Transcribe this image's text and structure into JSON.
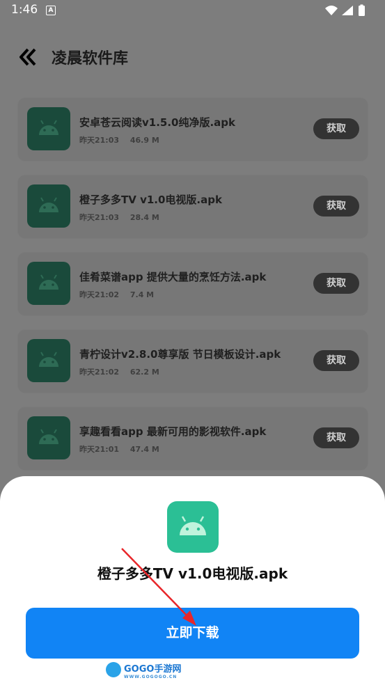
{
  "status_bar": {
    "time": "1:46",
    "notification_letter": "A"
  },
  "header": {
    "title": "凌晨软件库"
  },
  "list": {
    "get_label": "获取",
    "items": [
      {
        "name": "安卓苍云阅读v1.5.0纯净版.apk",
        "time": "昨天21:03",
        "size": "46.9  M"
      },
      {
        "name": "橙子多多TV  v1.0电视版.apk",
        "time": "昨天21:03",
        "size": "28.4  M"
      },
      {
        "name": "佳肴菜谱app  提供大量的烹饪方法.apk",
        "time": "昨天21:02",
        "size": "7.4  M"
      },
      {
        "name": "青柠设计v2.8.0尊享版  节日模板设计.apk",
        "time": "昨天21:02",
        "size": "62.2  M"
      },
      {
        "name": "享趣看看app  最新可用的影视软件.apk",
        "time": "昨天21:01",
        "size": "47.4  M"
      }
    ]
  },
  "sheet": {
    "file_name": "橙子多多TV v1.0电视版.apk",
    "download_label": "立即下载"
  },
  "watermark": {
    "brand": "GOGO手游网",
    "url": "WWW.GOGOGO.CN"
  },
  "colors": {
    "accent": "#1184f5",
    "icon_green": "#2bbf95",
    "android_green": "#3ddc84"
  }
}
